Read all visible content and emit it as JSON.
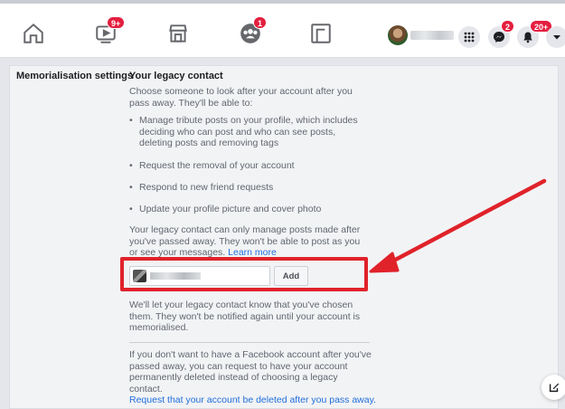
{
  "nav": {
    "badges": {
      "watch": "9+",
      "groups": "1",
      "messenger": "2",
      "notifications": "20+"
    }
  },
  "settings": {
    "side_label": "Memorialisation settings",
    "heading": "Your legacy contact",
    "intro": "Choose someone to look after your account after you pass away. They'll be able to:",
    "bullets": [
      "Manage tribute posts on your profile, which includes deciding who can post and who can see posts, deleting posts and removing tags",
      "Request the removal of your account",
      "Respond to new friend requests",
      "Update your profile picture and cover photo"
    ],
    "note": "Your legacy contact can only manage posts made after you've passed away. They won't be able to post as you or see your messages.",
    "learn_more": "Learn more",
    "add_button": "Add",
    "notify_text": "We'll let your legacy contact know that you've chosen them. They won't be notified again until your account is memorialised.",
    "delete_text": "If you don't want to have a Facebook account after you've passed away, you can request to have your account permanently deleted instead of choosing a legacy contact.",
    "delete_link": "Request that your account be deleted after you pass away."
  },
  "colors": {
    "accent": "#216fdb",
    "highlight": "#e0222a",
    "badge": "#e41e3f"
  }
}
